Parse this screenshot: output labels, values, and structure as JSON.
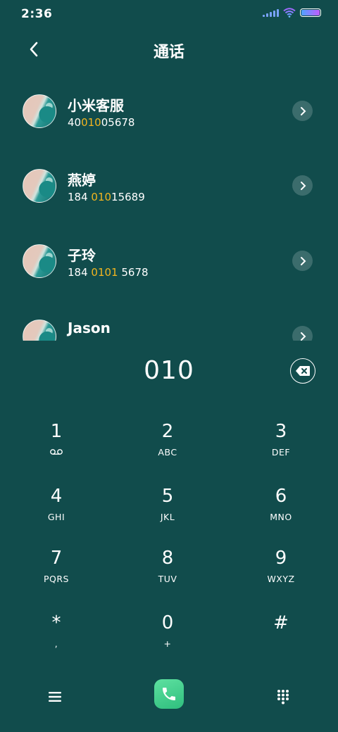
{
  "status_bar": {
    "time": "2:36"
  },
  "header": {
    "title": "通话"
  },
  "contacts": [
    {
      "name": "小米客服",
      "number_parts": [
        "40",
        "010",
        "05678"
      ]
    },
    {
      "name": "燕婷",
      "number_parts": [
        "184 ",
        "010",
        "15689"
      ]
    },
    {
      "name": "子玲",
      "number_parts": [
        "184 ",
        "0101",
        " 5678"
      ]
    },
    {
      "name": "Jason",
      "number_parts": [
        "",
        "",
        ""
      ]
    }
  ],
  "dialer": {
    "input_value": "010"
  },
  "keypad": [
    {
      "digit": "1",
      "letters": ""
    },
    {
      "digit": "2",
      "letters": "ABC"
    },
    {
      "digit": "3",
      "letters": "DEF"
    },
    {
      "digit": "4",
      "letters": "GHI"
    },
    {
      "digit": "5",
      "letters": "JKL"
    },
    {
      "digit": "6",
      "letters": "MNO"
    },
    {
      "digit": "7",
      "letters": "PQRS"
    },
    {
      "digit": "8",
      "letters": "TUV"
    },
    {
      "digit": "9",
      "letters": "WXYZ"
    },
    {
      "digit": "*",
      "letters": ","
    },
    {
      "digit": "0",
      "letters": "+"
    },
    {
      "digit": "#",
      "letters": ""
    }
  ],
  "icons": {
    "back": "chevron-left-icon",
    "detail": "chevron-right-icon",
    "backspace": "backspace-icon",
    "voicemail": "voicemail-icon",
    "menu": "menu-icon",
    "call": "phone-icon",
    "keypad": "dialpad-icon"
  },
  "colors": {
    "background": "#114c4c",
    "highlight": "#f3b51f",
    "call_button": "#3fcf8a"
  }
}
